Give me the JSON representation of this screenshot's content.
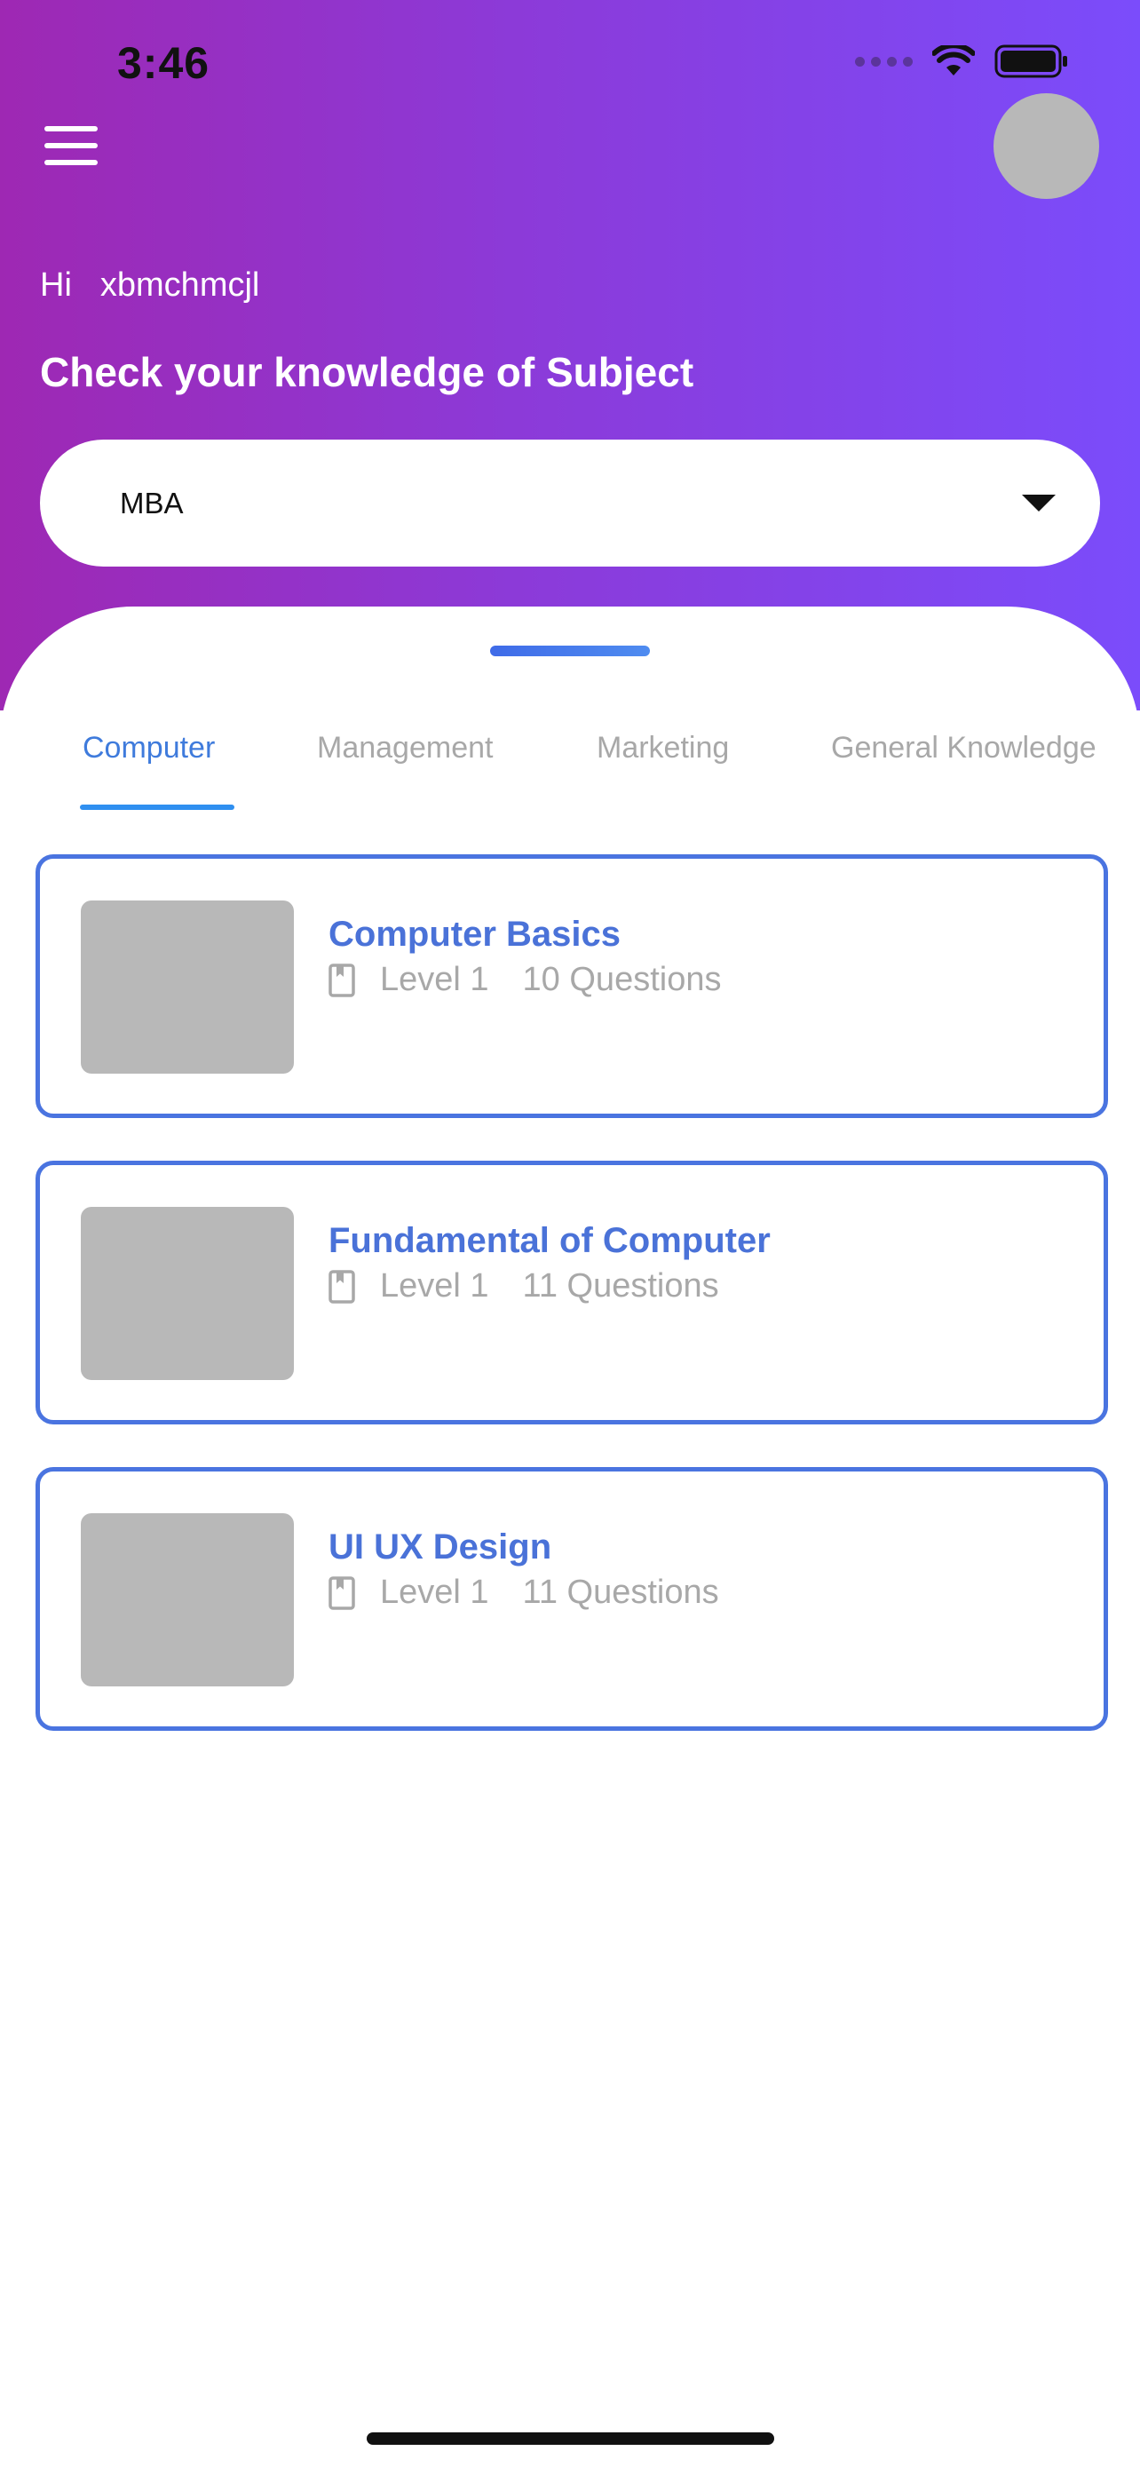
{
  "status_bar": {
    "time": "3:46"
  },
  "header": {
    "greeting_prefix": "Hi",
    "user_name": "xbmchmcjl",
    "headline": "Check your knowledge of Subject",
    "subject_select": {
      "selected": "MBA"
    }
  },
  "tabs": [
    {
      "label": "Computer",
      "active": true
    },
    {
      "label": "Management",
      "active": false
    },
    {
      "label": "Marketing",
      "active": false
    },
    {
      "label": "General Knowledge",
      "active": false
    }
  ],
  "quizzes": [
    {
      "title": "Computer Basics",
      "level": "Level 1",
      "questions": "10 Questions"
    },
    {
      "title": "Fundamental of Computer",
      "level": "Level 1",
      "questions": "11 Questions"
    },
    {
      "title": "UI UX Design",
      "level": "Level 1",
      "questions": "11 Questions"
    }
  ],
  "colors": {
    "gradient_start": "#9e28b3",
    "gradient_end": "#7b4cfb",
    "accent_blue": "#4a74e0",
    "tab_active": "#3f7bdc",
    "muted_text": "#a8a8a8"
  },
  "icons": {
    "menu": "hamburger-menu-icon",
    "dropdown": "caret-down-icon",
    "quiz_meta": "book-icon"
  }
}
